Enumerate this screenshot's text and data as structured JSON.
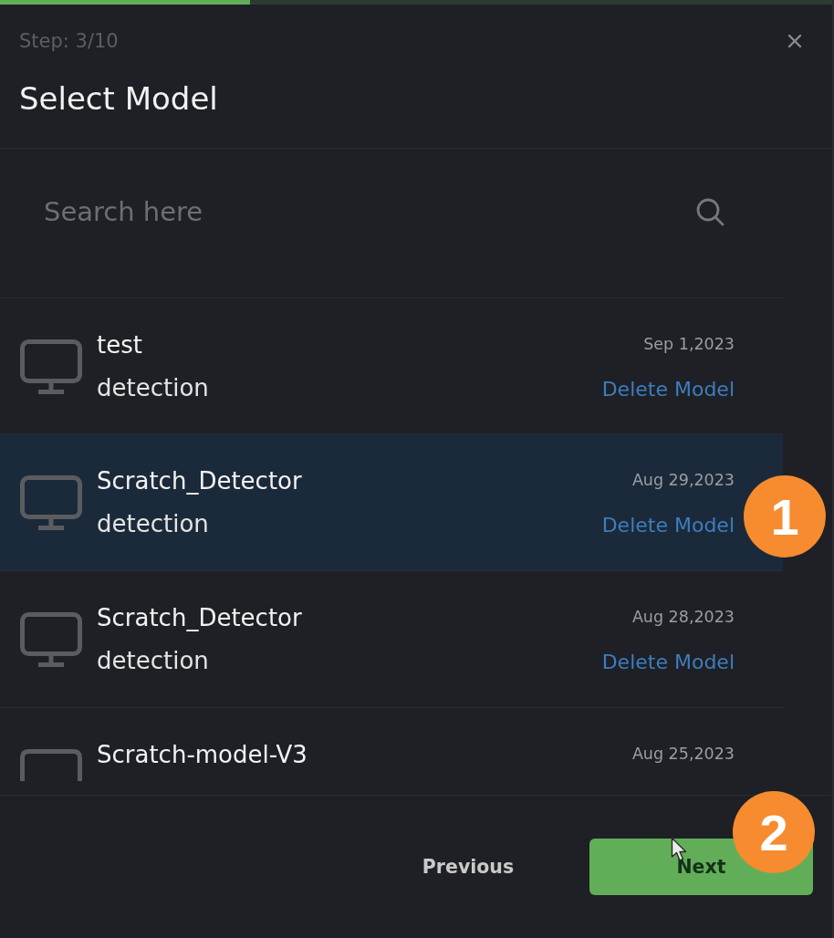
{
  "progress": {
    "level": 0.3
  },
  "header": {
    "step": "Step: 3/10",
    "title": "Select Model"
  },
  "search": {
    "placeholder": "Search here"
  },
  "models": [
    {
      "name": "test",
      "type": "detection",
      "date": "Sep 1,2023",
      "action": "Delete Model",
      "selected": false,
      "partial": false
    },
    {
      "name": "Scratch_Detector",
      "type": "detection",
      "date": "Aug 29,2023",
      "action": "Delete Model",
      "selected": true,
      "partial": false,
      "callout": "1"
    },
    {
      "name": "Scratch_Detector",
      "type": "detection",
      "date": "Aug 28,2023",
      "action": "Delete Model",
      "selected": false,
      "partial": false
    },
    {
      "name": "Scratch-model-V3",
      "date": "Aug 25,2023",
      "selected": false,
      "partial": true
    }
  ],
  "footer": {
    "buttons": [
      {
        "label": "Previous",
        "kind": "secondary"
      },
      {
        "label": "Next",
        "kind": "primary",
        "callout": "2"
      }
    ]
  }
}
